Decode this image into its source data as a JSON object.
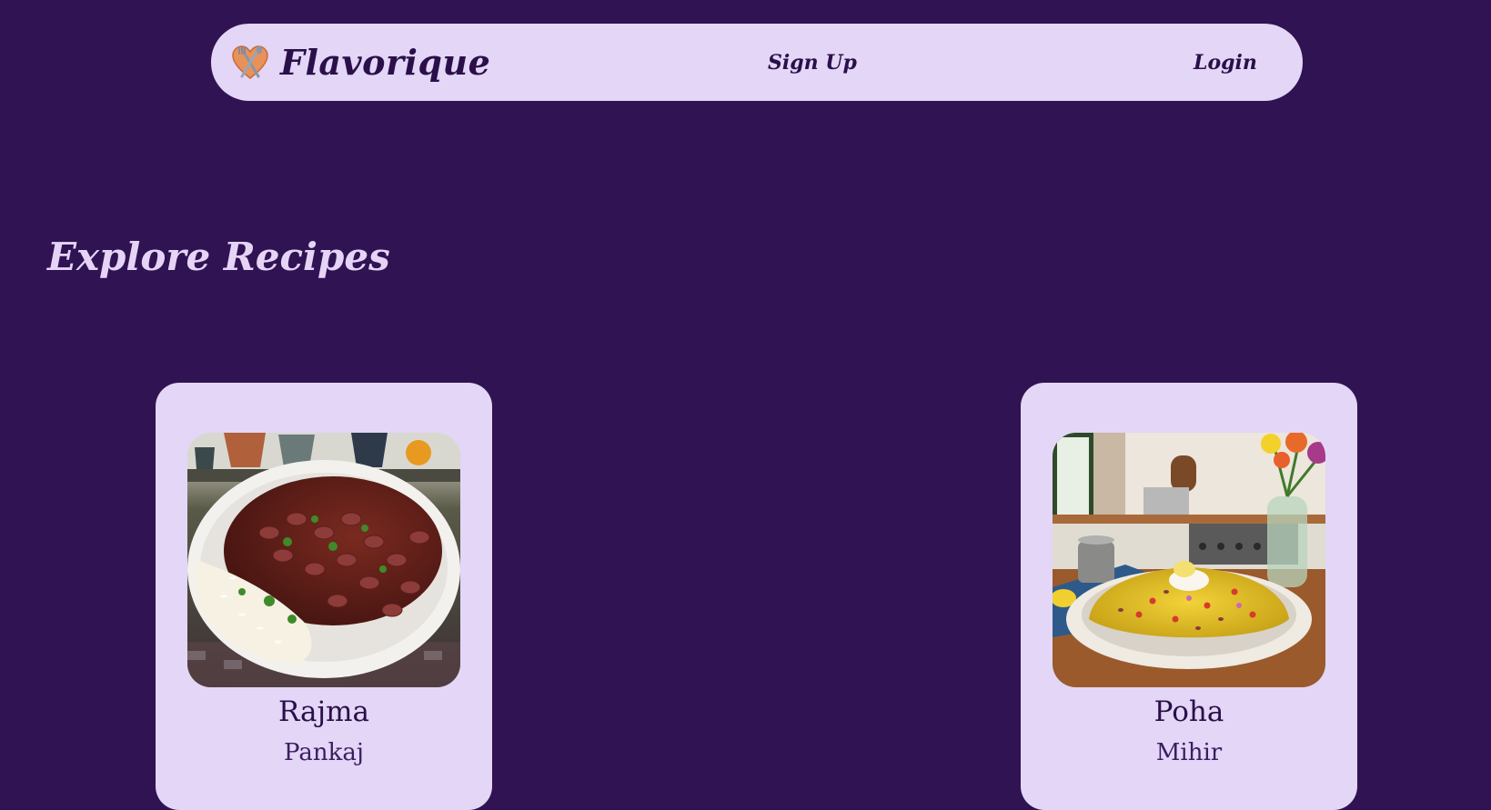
{
  "colors": {
    "background": "#301352",
    "surface": "#e3d6f6",
    "text_dark": "#2b0f4a",
    "heading_light": "#e6d4f6"
  },
  "nav": {
    "brand": "Flavorique",
    "logo_icon": "utensils-heart-icon",
    "signup_label": "Sign Up",
    "login_label": "Login"
  },
  "page": {
    "title": "Explore Recipes"
  },
  "recipes": [
    {
      "title": "Rajma",
      "author": "Pankaj",
      "image": "rajma-rice-bowl-photo"
    },
    {
      "title": "Poha",
      "author": "Mihir",
      "image": "poha-plate-photo"
    }
  ]
}
